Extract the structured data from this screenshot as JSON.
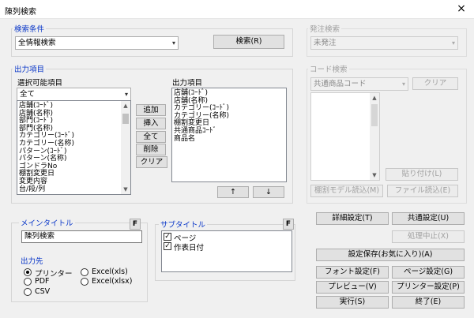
{
  "window": {
    "title": "陳列検索",
    "close_symbol": "×"
  },
  "search_condition": {
    "legend": "検索条件",
    "combo_value": "全情報検索",
    "search_button": "検索(R)"
  },
  "order_search": {
    "legend": "発注検索",
    "combo_value": "未発注"
  },
  "output_items": {
    "legend": "出力項目",
    "selectable_label": "選択可能項目",
    "filter_value": "全て",
    "selectable_list": [
      "店舗(ｺｰﾄﾞ)",
      "店舗(名称)",
      "部門(ｺｰﾄﾞ)",
      "部門(名称)",
      "カテゴリー(ｺｰﾄﾞ)",
      "カテゴリー(名称)",
      "パターン(ｺｰﾄﾞ)",
      "パターン(名称)",
      "ゴンドラNo",
      "棚割変更日",
      "変更内容",
      "台/段/列"
    ],
    "output_label": "出力項目",
    "output_list": [
      "店舗(ｺｰﾄﾞ)",
      "店舗(名称)",
      "カテゴリー(ｺｰﾄﾞ)",
      "カテゴリー(名称)",
      "棚割変更日",
      "共通商品ｺｰﾄﾞ",
      "商品名"
    ],
    "buttons": {
      "add": "追加",
      "insert": "挿入",
      "all": "全て",
      "delete": "削除",
      "clear": "クリア"
    },
    "up_arrow": "↑",
    "down_arrow": "↓"
  },
  "code_search": {
    "legend": "コード検索",
    "combo_value": "共通商品コード",
    "clear_button": "クリア",
    "paste_button": "貼り付け(L)",
    "shelf_model_button": "棚割モデル読込(M)",
    "file_load_button": "ファイル読込(E)"
  },
  "main_title": {
    "legend": "メインタイトル",
    "f_button": "F",
    "value": "陳列検索"
  },
  "sub_title": {
    "legend": "サブタイトル",
    "f_button": "F",
    "items": [
      {
        "label": "ページ",
        "checked": true,
        "mark": "✓"
      },
      {
        "label": "作表日付",
        "checked": true,
        "mark": "✓"
      }
    ]
  },
  "output_dest": {
    "legend": "出力先",
    "options": [
      {
        "label": "プリンター",
        "checked": true
      },
      {
        "label": "Excel(xls)",
        "checked": false
      },
      {
        "label": "PDF",
        "checked": false
      },
      {
        "label": "Excel(xlsx)",
        "checked": false
      },
      {
        "label": "CSV",
        "checked": false
      }
    ]
  },
  "actions": {
    "detail_settings": "詳細設定(T)",
    "common_settings": "共通設定(U)",
    "cancel_process": "処理中止(X)",
    "save_settings": "設定保存(お気に入り)(A)",
    "font_settings": "フォント設定(F)",
    "page_settings": "ページ設定(G)",
    "preview": "プレビュー(V)",
    "printer_settings": "プリンター設定(P)",
    "execute": "実行(S)",
    "exit": "終了(E)"
  },
  "colors": {
    "legend_blue": "#0a37c8",
    "background": "#f0f0f0"
  }
}
